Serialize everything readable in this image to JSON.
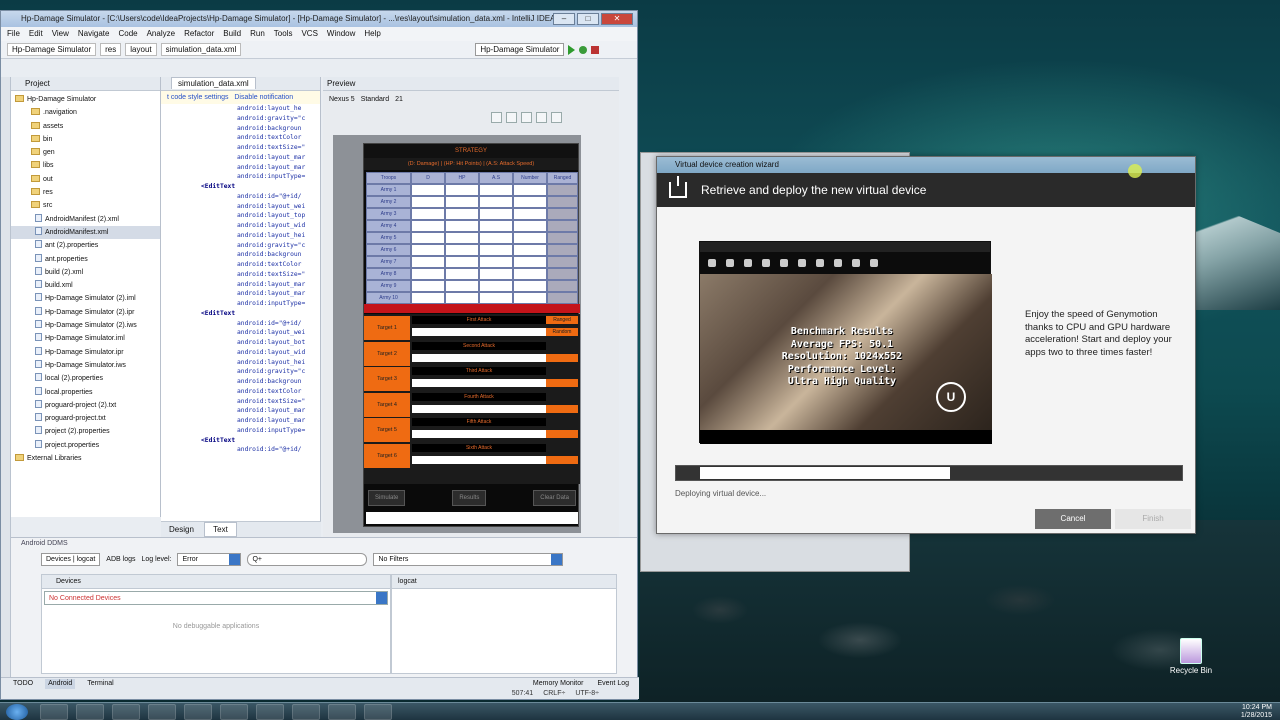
{
  "ide": {
    "title": "Hp-Damage Simulator - [C:\\Users\\code\\IdeaProjects\\Hp-Damage Simulator] - [Hp-Damage Simulator] - ...\\res\\layout\\simulation_data.xml - IntelliJ IDEA",
    "menu": [
      "File",
      "Edit",
      "View",
      "Navigate",
      "Code",
      "Analyze",
      "Refactor",
      "Build",
      "Run",
      "Tools",
      "VCS",
      "Window",
      "Help"
    ],
    "breadcrumbs": [
      "Hp-Damage Simulator",
      "res",
      "layout",
      "simulation_data.xml"
    ],
    "run_config": "Hp-Damage Simulator",
    "project_panel_label": "Project",
    "tree": [
      {
        "label": "Hp-Damage Simulator",
        "type": "root"
      },
      {
        "label": ".navigation",
        "type": "folder"
      },
      {
        "label": "assets",
        "type": "folder"
      },
      {
        "label": "bin",
        "type": "folder"
      },
      {
        "label": "gen",
        "type": "folder"
      },
      {
        "label": "libs",
        "type": "folder"
      },
      {
        "label": "out",
        "type": "folder"
      },
      {
        "label": "res",
        "type": "folder"
      },
      {
        "label": "src",
        "type": "folder"
      },
      {
        "label": "AndroidManifest (2).xml",
        "type": "file"
      },
      {
        "label": "AndroidManifest.xml",
        "type": "file"
      },
      {
        "label": "ant (2).properties",
        "type": "file"
      },
      {
        "label": "ant.properties",
        "type": "file"
      },
      {
        "label": "build (2).xml",
        "type": "file"
      },
      {
        "label": "build.xml",
        "type": "file"
      },
      {
        "label": "Hp-Damage Simulator (2).iml",
        "type": "file"
      },
      {
        "label": "Hp-Damage Simulator (2).ipr",
        "type": "file"
      },
      {
        "label": "Hp-Damage Simulator (2).iws",
        "type": "file"
      },
      {
        "label": "Hp-Damage Simulator.iml",
        "type": "file"
      },
      {
        "label": "Hp-Damage Simulator.ipr",
        "type": "file"
      },
      {
        "label": "Hp-Damage Simulator.iws",
        "type": "file"
      },
      {
        "label": "local (2).properties",
        "type": "file"
      },
      {
        "label": "local.properties",
        "type": "file"
      },
      {
        "label": "proguard-project (2).txt",
        "type": "file"
      },
      {
        "label": "proguard-project.txt",
        "type": "file"
      },
      {
        "label": "project (2).properties",
        "type": "file"
      },
      {
        "label": "project.properties",
        "type": "file"
      },
      {
        "label": "External Libraries",
        "type": "root"
      }
    ],
    "editor_tab": "simulation_data.xml",
    "notice_links": [
      "t code style settings",
      "Disable notification"
    ],
    "code_lines": [
      "android:layout_he",
      "android:gravity=\"c",
      "android:backgroun",
      "android:textColor",
      "android:textSize=\"",
      "android:layout_mar",
      "android:layout_mar",
      "android:inputType=",
      "<EditText",
      "android:id=\"@+id/",
      "android:layout_wei",
      "android:layout_top",
      "android:layout_wid",
      "android:layout_hei",
      "android:gravity=\"c",
      "android:backgroun",
      "android:textColor",
      "android:textSize=\"",
      "android:layout_mar",
      "android:layout_mar",
      "android:inputType=",
      "<EditText",
      "android:id=\"@+id/",
      "android:layout_wei",
      "android:layout_bot",
      "android:layout_wid",
      "android:layout_hei",
      "android:gravity=\"c",
      "android:backgroun",
      "android:textColor",
      "android:textSize=\"",
      "android:layout_mar",
      "android:layout_mar",
      "android:inputType=",
      "<EditText",
      "android:id=\"@+id/"
    ],
    "design_tabs": [
      "Design",
      "Text"
    ],
    "preview": {
      "label": "Preview",
      "device": "Nexus 5",
      "theme": "Standard",
      "api": "21"
    },
    "app": {
      "title": "STRATEGY",
      "subtitle": "(D: Damage) | (HP: Hit Points) | (A.S: Attack Speed)",
      "columns": [
        "Troops",
        "D",
        "HP",
        "A.S",
        "Number",
        "Ranged"
      ],
      "armies": [
        "Army 1",
        "Army 2",
        "Army 3",
        "Army 4",
        "Army 5",
        "Army 6",
        "Army 7",
        "Army 8",
        "Army 9",
        "Army 10"
      ],
      "targets": [
        "Target 1",
        "Target 2",
        "Target 3",
        "Target 4",
        "Target 5",
        "Target 6"
      ],
      "attacks": [
        "First Attack",
        "Second Attack",
        "Third Attack",
        "Fourth Attack",
        "Fifth Attack",
        "Sixth Attack"
      ],
      "ranged_label": "Ranged",
      "sub_columns": [
        "D",
        "HP",
        "A.S",
        "Number"
      ],
      "sub_ranged": "Random",
      "buttons": [
        "Simulate",
        "Results",
        "Clear Data"
      ]
    },
    "ddms": {
      "label": "Android DDMS",
      "tab_devices": "Devices | logcat",
      "tab_adb": "ADB logs",
      "log_level_label": "Log level:",
      "log_level": "Error",
      "search_placeholder": "Q+",
      "filter": "No Filters",
      "devices_label": "Devices",
      "logcat_label": "logcat",
      "no_devices": "No Connected Devices",
      "no_debuggable": "No debuggable applications"
    },
    "bottom_tabs": [
      "TODO",
      "Android",
      "Terminal"
    ],
    "bottom_right": [
      "Memory Monitor",
      "Event Log"
    ],
    "status": [
      "507:41",
      "CRLF÷",
      "UTF-8÷"
    ]
  },
  "wizard": {
    "window_title": "Virtual device creation wizard",
    "heading": "Retrieve and deploy the new virtual device",
    "benchmark": [
      "Benchmark Results",
      "Average FPS: 50.1",
      "Resolution: 1024x552",
      "Performance Level:",
      "Ultra High Quality"
    ],
    "promo": "Enjoy the speed of Genymotion thanks to CPU and GPU hardware acceleration! Start and deploy your apps two to three times faster!",
    "progress_fraction": 0.54,
    "status": "Deploying virtual device...",
    "cancel": "Cancel",
    "finish": "Finish"
  },
  "desktop": {
    "recycle_bin": "Recycle Bin"
  },
  "taskbar": {
    "time": "10:24 PM",
    "date": "1/28/2015"
  }
}
